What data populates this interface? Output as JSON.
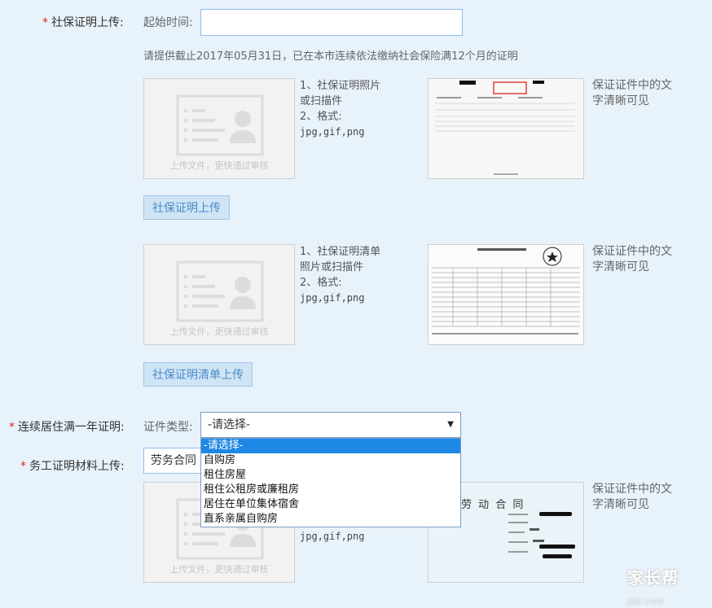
{
  "social": {
    "label": "社保证明上传:",
    "start_label": "起始时间:",
    "start_value": "",
    "note": "请提供截止2017年05月31日，已在本市连续依法缴纳社会保险满12个月的证明",
    "block1": {
      "hint1": "1、社保证明照片或扫描件",
      "hint2": "2、格式:",
      "formats": "jpg,gif,png",
      "upload_hint": "上传文件，更快通过审核",
      "sample_note": "保证证件中的文字清晰可见",
      "button": "社保证明上传"
    },
    "block2": {
      "hint1": "1、社保证明清单照片或扫描件",
      "hint2": "2、格式:",
      "formats": "jpg,gif,png",
      "upload_hint": "上传文件，更快通过审核",
      "sample_note": "保证证件中的文字清晰可见",
      "button": "社保证明清单上传"
    }
  },
  "residence": {
    "label": "连续居住满一年证明:",
    "type_label": "证件类型:",
    "selected": "-请选择-",
    "options": [
      "-请选择-",
      "自购房",
      "租住房屋",
      "租住公租房或廉租房",
      "居住在单位集体宿舍",
      "直系亲属自购房"
    ]
  },
  "work": {
    "label": "务工证明材料上传:",
    "select_value": "劳务合同",
    "formats": "jpg,gif,png",
    "upload_hint": "上传文件，更快通过审核",
    "sample_note": "保证证件中的文字清晰可见",
    "sample_title": "劳 动 合 同"
  },
  "watermark": {
    "brand": "家长帮",
    "site": "jzb.com"
  },
  "colors": {
    "required": "#e02020",
    "button_bg": "#cfe4f5",
    "button_text": "#4a8bc9",
    "selected_option": "#1e88e5",
    "page_bg": "#e8f2fb"
  }
}
